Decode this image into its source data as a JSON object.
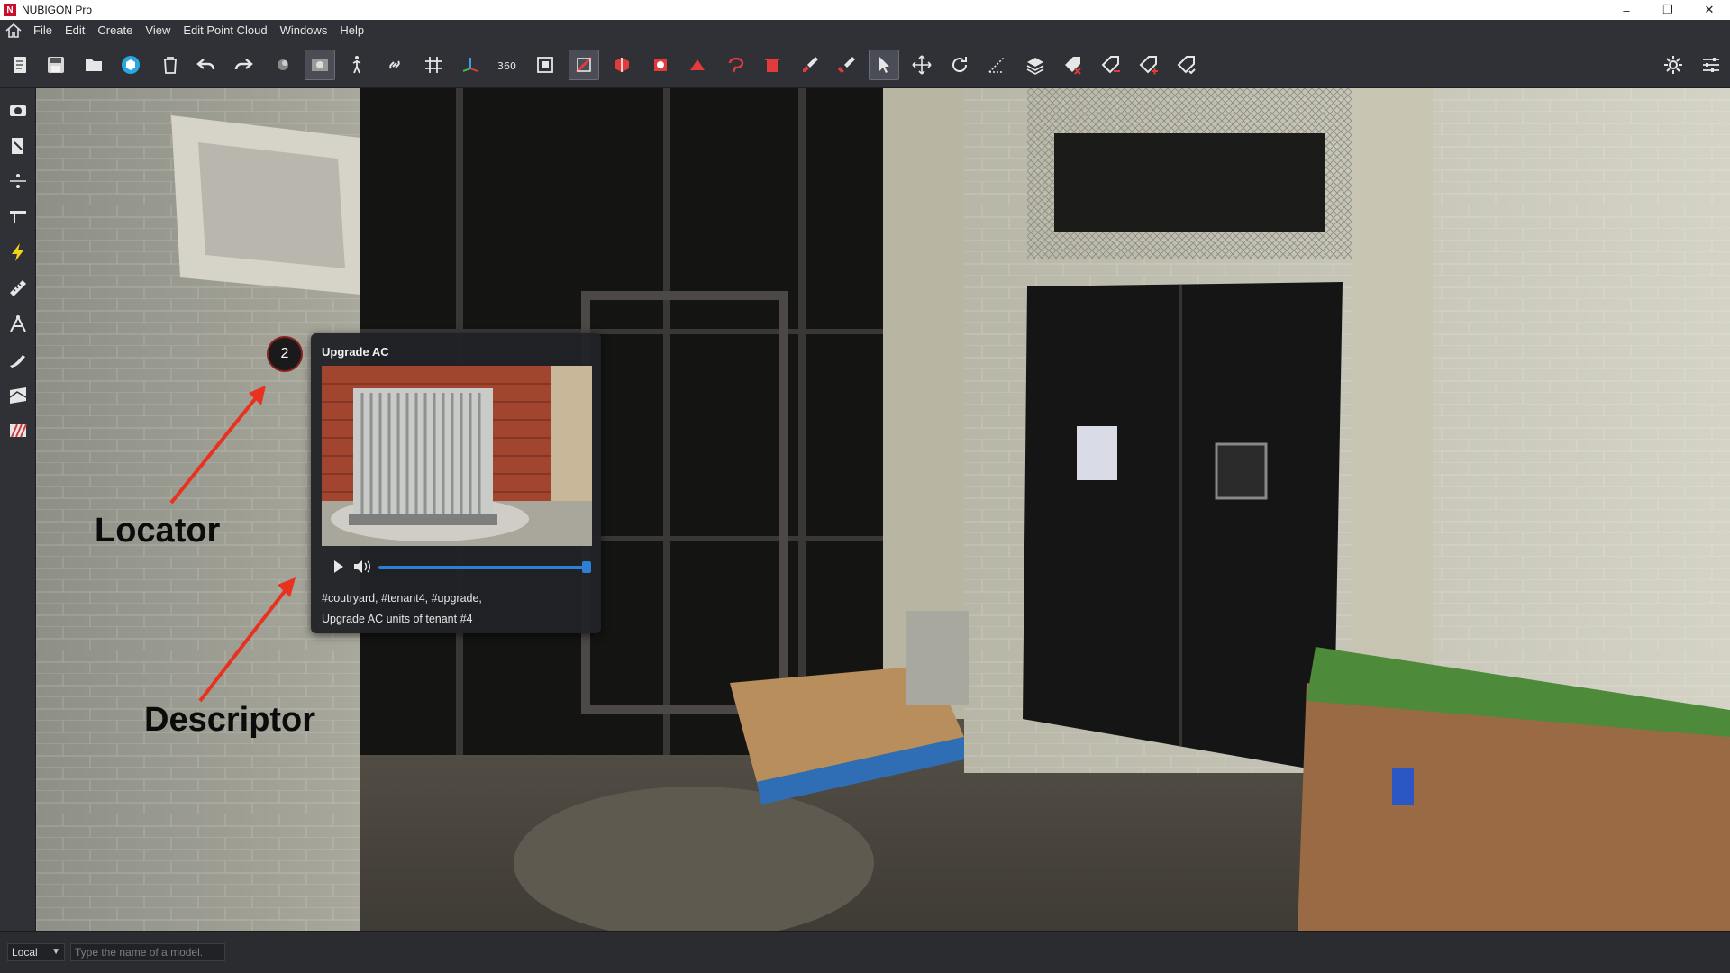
{
  "window": {
    "title": "NUBIGON Pro",
    "logo_letter": "N",
    "minimize": "–",
    "restore": "❐",
    "close": "✕"
  },
  "menu": [
    "File",
    "Edit",
    "Create",
    "View",
    "Edit Point Cloud",
    "Windows",
    "Help"
  ],
  "toolbar_icons": [
    "new-file-icon",
    "save-icon",
    "open-folder-icon",
    "cube-icon",
    "delete-icon",
    "undo-icon",
    "redo-icon",
    "light-icon",
    "render-icon",
    "walk-icon",
    "link-icon",
    "grid-icon",
    "axes-icon",
    "360-icon",
    "frame-icon",
    "section-box-icon",
    "section-red-icon",
    "clip-icon",
    "crop-icon",
    "lasso-icon",
    "trash-points-icon",
    "brush-icon",
    "erase-icon",
    "select-cursor-icon",
    "move-icon",
    "rotate-icon",
    "measure-icon",
    "layers-icon",
    "tag-icon",
    "tag-remove-icon",
    "tag-add-icon",
    "tag-check-icon",
    "settings-icon",
    "sliders-icon"
  ],
  "left_icons": [
    "camera-icon",
    "marker-icon",
    "align-icon",
    "pin-icon",
    "lightning-icon",
    "ruler-icon",
    "waypoint-icon",
    "paint-icon",
    "texture-icon",
    "stripes-icon"
  ],
  "annotation": {
    "number": "2",
    "title": "Upgrade AC",
    "tags": "#coutryard, #tenant4, #upgrade,",
    "description": "Upgrade AC units of tenant #4",
    "progress": 1.0
  },
  "callouts": {
    "locator": "Locator",
    "descriptor": "Descriptor"
  },
  "statusbar": {
    "coordinate_mode": "Local",
    "model_placeholder": "Type the name of a model."
  },
  "colors": {
    "accent_blue": "#2d7fd4",
    "callout_arrow": "#e8321f",
    "locator_border": "#8a1f1f"
  }
}
